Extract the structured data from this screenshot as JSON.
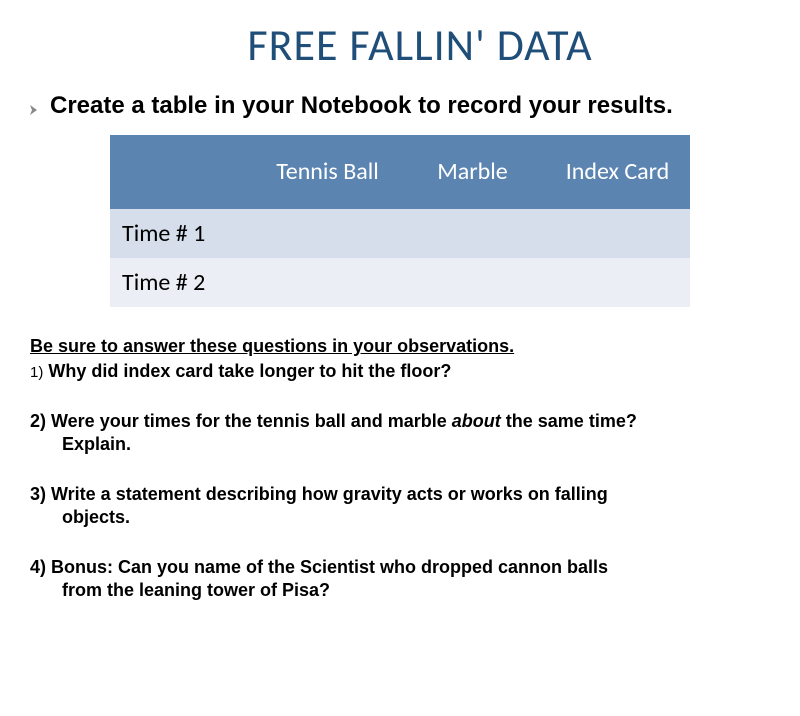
{
  "title": "FREE FALLIN' DATA",
  "instruction": "Create a table in your Notebook to record your results.",
  "table": {
    "headers": [
      "",
      "Tennis Ball",
      "Marble",
      "Index Card"
    ],
    "rows": [
      {
        "label": "Time # 1",
        "c1": "",
        "c2": "",
        "c3": ""
      },
      {
        "label": "Time # 2",
        "c1": "",
        "c2": "",
        "c3": ""
      }
    ]
  },
  "questions": {
    "intro": "Be sure to answer these questions in your observations.",
    "q1_num": "1)",
    "q1_text": " Why did index card take longer to hit the floor?",
    "q2_pre": "2) Were your times for the tennis ball and marble ",
    "q2_about": "about",
    "q2_post": " the same time?",
    "q2_indent": "Explain.",
    "q3_main": "3) Write a statement describing how gravity acts or works on falling",
    "q3_indent": "objects.",
    "q4_main": "4) Bonus: Can you name of the Scientist who dropped cannon balls",
    "q4_indent": "from the leaning tower of Pisa?"
  }
}
